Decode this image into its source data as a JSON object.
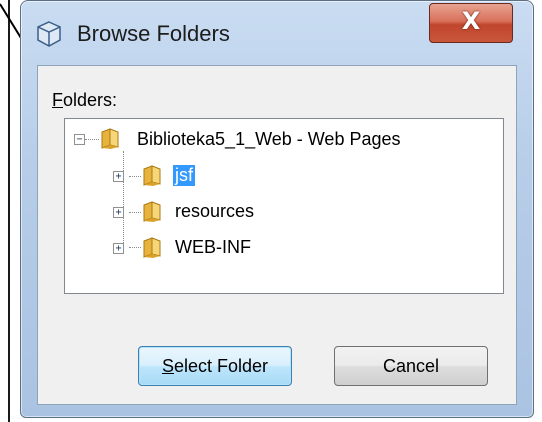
{
  "window": {
    "title": "Browse Folders",
    "close_label": "X"
  },
  "folders_label": {
    "accel": "F",
    "rest": "olders:"
  },
  "tree": {
    "root": {
      "label": "Biblioteka5_1_Web - Web Pages",
      "expander": "−"
    },
    "children": [
      {
        "label": "jsf",
        "expander": "+",
        "selected": true
      },
      {
        "label": "resources",
        "expander": "+",
        "selected": false
      },
      {
        "label": "WEB-INF",
        "expander": "+",
        "selected": false
      }
    ]
  },
  "buttons": {
    "select_accel": "S",
    "select_rest": "elect Folder",
    "cancel": "Cancel"
  },
  "colors": {
    "selection": "#3399ff",
    "close_button": "#c9563c",
    "frame": "#b7cde8"
  },
  "icons": {
    "title": "folder-browse-icon",
    "folder": "folder-icon",
    "arrow": "annotation-arrow"
  }
}
